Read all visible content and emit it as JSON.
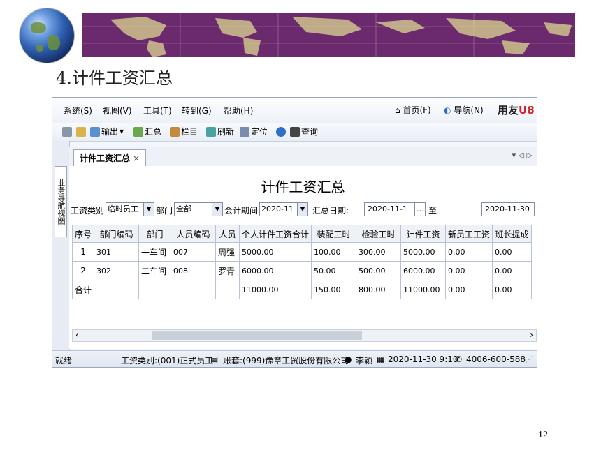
{
  "slide": {
    "title": "4.计件工资汇总",
    "page_number": "12"
  },
  "menubar": {
    "items": [
      "系统(S)",
      "视图(V)",
      "工具(T)",
      "转到(G)",
      "帮助(H)"
    ],
    "home": "首页(F)",
    "navigation": "导航(N)",
    "brand_text": "用友",
    "brand_mark": "U8"
  },
  "toolbar": {
    "export": "输出",
    "summary": "汇总",
    "columns": "栏目",
    "refresh": "刷新",
    "locate": "定位",
    "query": "查询"
  },
  "left_rail": {
    "tab": "业务导航视图"
  },
  "tab": {
    "label": "计件工资汇总",
    "close": "×"
  },
  "tabnav": "▾ ◁ ▷",
  "report": {
    "title": "计件工资汇总",
    "filters": {
      "wage_category_label": "工资类别",
      "wage_category_value": "临时员工",
      "dept_label": "部门",
      "dept_value": "全部",
      "period_label": "会计期间",
      "period_value": "2020-11",
      "date_label": "汇总日期:",
      "date_from": "2020-11-1",
      "to_label": "至",
      "date_to": "2020-11-30"
    },
    "columns": [
      "序号",
      "部门编码",
      "部门",
      "人员编码",
      "人员",
      "个人计件工资合计",
      "装配工时",
      "检验工时",
      "计件工资",
      "新员工工资",
      "班长提成"
    ],
    "rows": [
      [
        "1",
        "301",
        "一车间",
        "007",
        "周强",
        "5000.00",
        "100.00",
        "300.00",
        "5000.00",
        "0.00",
        "0.00"
      ],
      [
        "2",
        "302",
        "二车间",
        "008",
        "罗青",
        "6000.00",
        "50.00",
        "500.00",
        "6000.00",
        "0.00",
        "0.00"
      ],
      [
        "合计",
        "",
        "",
        "",
        "",
        "11000.00",
        "150.00",
        "800.00",
        "11000.00",
        "0.00",
        "0.00"
      ]
    ]
  },
  "statusbar": {
    "ready": "就绪",
    "wage_category": "工资类别:(001)正式员工",
    "account": "账套:(999)豫章工贸股份有限公司",
    "user": "李颖",
    "datetime": "2020-11-30 9:10",
    "phone": "4006-600-588"
  },
  "colors": {
    "banner": "#6b2a6e",
    "brand_red": "#d2232a"
  }
}
